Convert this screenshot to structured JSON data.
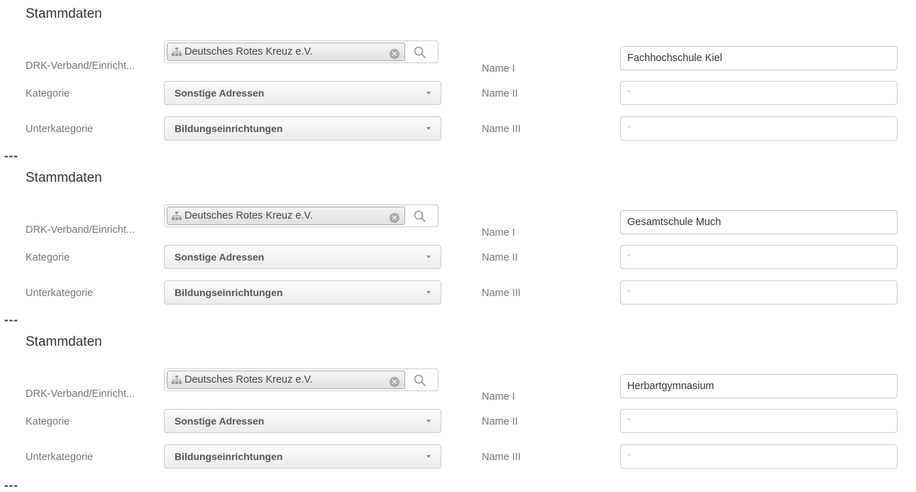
{
  "separator": "---",
  "labels": {
    "verband": "DRK-Verband/Einricht...",
    "kategorie": "Kategorie",
    "unterkategorie": "Unterkategorie",
    "name1": "Name I",
    "name2": "Name II",
    "name3": "Name III"
  },
  "icons": {
    "org": "org-structure-icon",
    "clear": "clear-icon",
    "search": "search-icon",
    "caret": "chevron-down-icon"
  },
  "sections": [
    {
      "title": "Stammdaten",
      "verband": "Deutsches Rotes Kreuz e.V.",
      "kategorie": "Sonstige Adressen",
      "unterkategorie": "Bildungseinrichtungen",
      "name1": "Fachhochschule Kiel",
      "name2_placeholder": "''",
      "name3_placeholder": "''"
    },
    {
      "title": "Stammdaten",
      "verband": "Deutsches Rotes Kreuz e.V.",
      "kategorie": "Sonstige Adressen",
      "unterkategorie": "Bildungseinrichtungen",
      "name1": "Gesamtschule Much",
      "name2_placeholder": "''",
      "name3_placeholder": "''"
    },
    {
      "title": "Stammdaten",
      "verband": "Deutsches Rotes Kreuz e.V.",
      "kategorie": "Sonstige Adressen",
      "unterkategorie": "Bildungseinrichtungen",
      "name1": "Herbartgymnasium",
      "name2_placeholder": "''",
      "name3_placeholder": "''"
    }
  ]
}
